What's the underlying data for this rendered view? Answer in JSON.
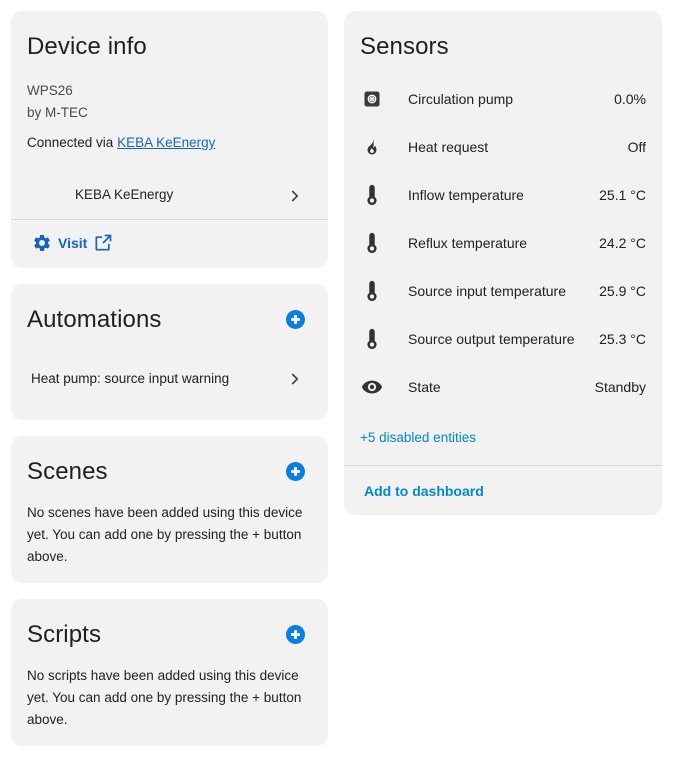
{
  "device_info": {
    "title": "Device info",
    "model": "WPS26",
    "manufacturer": "by M-TEC",
    "connected_prefix": "Connected via ",
    "connected_link": "KEBA KeEnergy",
    "hub_item": "KEBA KeEnergy",
    "visit_label": "Visit"
  },
  "automations": {
    "title": "Automations",
    "items": [
      "Heat pump: source input warning"
    ]
  },
  "scenes": {
    "title": "Scenes",
    "empty_text": "No scenes have been added using this device yet. You can add one by pressing the + button above."
  },
  "scripts": {
    "title": "Scripts",
    "empty_text": "No scripts have been added using this device yet. You can add one by pressing the + button above."
  },
  "sensors": {
    "title": "Sensors",
    "items": [
      {
        "name": "Circulation pump",
        "value": "0.0%",
        "icon": "pump-icon"
      },
      {
        "name": "Heat request",
        "value": "Off",
        "icon": "fire-icon"
      },
      {
        "name": "Inflow temperature",
        "value": "25.1 °C",
        "icon": "thermometer-icon"
      },
      {
        "name": "Reflux temperature",
        "value": "24.2 °C",
        "icon": "thermometer-icon"
      },
      {
        "name": "Source input temperature",
        "value": "25.9 °C",
        "icon": "thermometer-icon"
      },
      {
        "name": "Source output temperature",
        "value": "25.3 °C",
        "icon": "thermometer-icon"
      },
      {
        "name": "State",
        "value": "Standby",
        "icon": "eye-icon"
      }
    ],
    "disabled_link": "+5 disabled entities",
    "add_to_dashboard": "Add to dashboard"
  },
  "colors": {
    "accent": "#0288d1",
    "add_button": "#0a7fe2",
    "link": "#1565c0",
    "card_bg": "#f2f2f2"
  }
}
